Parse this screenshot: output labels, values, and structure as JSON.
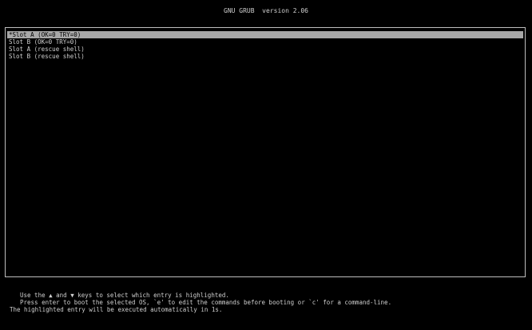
{
  "header": {
    "title": "GNU GRUB  version 2.06"
  },
  "menu": {
    "entries": [
      {
        "label": "*Slot A (OK=0 TRY=0)",
        "selected": true
      },
      {
        "label": "Slot B (OK=0 TRY=0)",
        "selected": false
      },
      {
        "label": "Slot A (rescue shell)",
        "selected": false
      },
      {
        "label": "Slot B (rescue shell)",
        "selected": false
      }
    ]
  },
  "help": {
    "line1": "Use the ▲ and ▼ keys to select which entry is highlighted.",
    "line2": "Press enter to boot the selected OS, `e' to edit the commands before booting or `c' for a command-line.",
    "line3": "The highlighted entry will be executed automatically in 1s."
  },
  "colors": {
    "background": "#000000",
    "text": "#cfcfcf",
    "highlight": "#a8a8a8"
  }
}
